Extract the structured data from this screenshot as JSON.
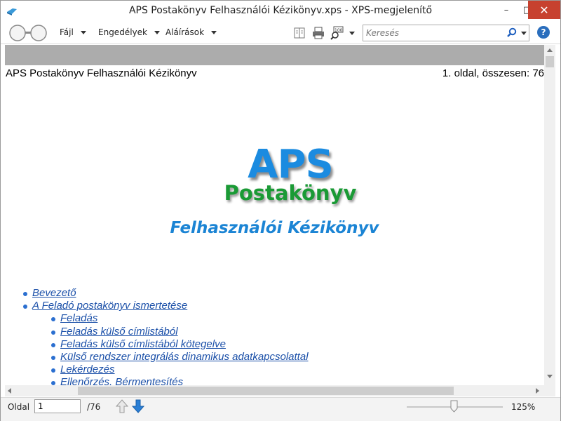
{
  "window": {
    "title": "APS Postakönyv Felhasználói Kézikönyv.xps - XPS-megjelenítő",
    "minimize_glyph": "–",
    "maximize_glyph": "□",
    "close_glyph": "✕"
  },
  "toolbar": {
    "menus": [
      {
        "label": "Fájl"
      },
      {
        "label": "Engedélyek"
      },
      {
        "label": "Aláírások"
      }
    ],
    "icons": [
      "reading-view-icon",
      "print-icon",
      "zoom-icon"
    ],
    "search": {
      "placeholder": "Keresés"
    },
    "help_glyph": "?"
  },
  "document": {
    "header_left": "APS Postakönyv Felhasználói Kézikönyv",
    "header_right": "1. oldal, összesen: 76",
    "logo": {
      "line1": "APS",
      "line2": "Postakönyv"
    },
    "title": "Felhasználói Kézikönyv",
    "toc": [
      {
        "label": "Bevezető",
        "level": 1
      },
      {
        "label": "A Feladó postakönyv ismertetése",
        "level": 1
      },
      {
        "label": "Feladás",
        "level": 2
      },
      {
        "label": "Feladás külső címlistából",
        "level": 2
      },
      {
        "label": "Feladás külső címlistából kötegelve",
        "level": 2
      },
      {
        "label": "Külső rendszer integrálás dinamikus adatkapcsolattal",
        "level": 2
      },
      {
        "label": "Lekérdezés",
        "level": 2
      },
      {
        "label": "Ellenőrzés, Bérmentesítés",
        "level": 2
      }
    ]
  },
  "statusbar": {
    "page_label": "Oldal",
    "page_value": "1",
    "page_total": "/76",
    "zoom": "125%",
    "zoom_fraction": 0.49
  },
  "colors": {
    "accent": "#1b84d4",
    "link": "#1a4fa8",
    "logo_green": "#1a9a35",
    "close_red": "#c7412f"
  }
}
